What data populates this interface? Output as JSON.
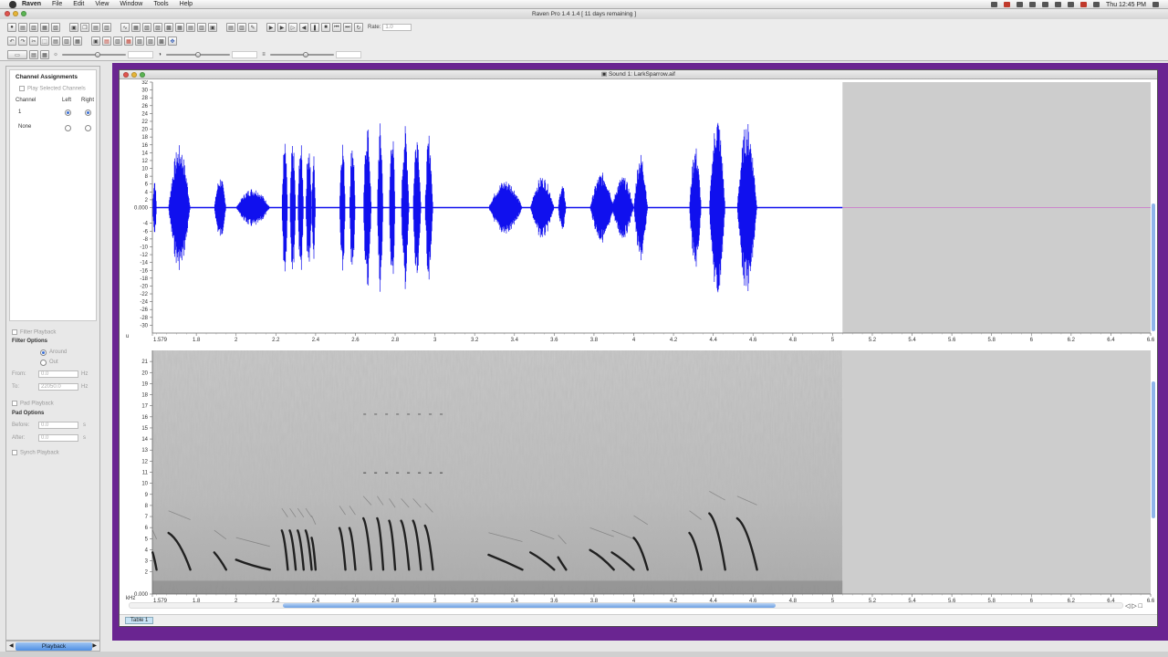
{
  "menubar": {
    "app": "Raven",
    "menus": [
      "File",
      "Edit",
      "View",
      "Window",
      "Tools",
      "Help"
    ],
    "clock": "Thu 12:45 PM"
  },
  "window": {
    "title": "Raven Pro 1.4  1.4  [ 11 days remaining ]"
  },
  "toolbar": {
    "rate_label": "Rate:",
    "rate_value": "1.0"
  },
  "channel_panel": {
    "title": "Channel Assignments",
    "play_selected": "Play Selected Channels",
    "col_channel": "Channel",
    "col_left": "Left",
    "col_right": "Right",
    "row1": "1",
    "row2": "None"
  },
  "filter": {
    "filter_playback": "Filter Playback",
    "title": "Filter Options",
    "around": "Around",
    "out": "Out",
    "from_label": "From:",
    "from_value": "0.0",
    "from_unit": "Hz",
    "to_label": "To:",
    "to_value": "22050.0",
    "to_unit": "Hz"
  },
  "pad": {
    "pad_playback": "Pad Playback",
    "title": "Pad Options",
    "before_label": "Before:",
    "before_value": "0.0",
    "before_unit": "s",
    "after_label": "After:",
    "after_value": "0.0",
    "after_unit": "s"
  },
  "synch": "Synch Playback",
  "side_tab": "Playback",
  "sound_window": {
    "title": "Sound 1: LarkSparrow.aif"
  },
  "table_tab": "Table 1",
  "waveform": {
    "unit_label": "u",
    "y_ticks": [
      "32",
      "30",
      "28",
      "26",
      "24",
      "22",
      "20",
      "18",
      "16",
      "14",
      "12",
      "10",
      "8",
      "6",
      "4",
      "2",
      "0.000",
      "-4",
      "-6",
      "-8",
      "-10",
      "-12",
      "-14",
      "-16",
      "-18",
      "-20",
      "-22",
      "-24",
      "-26",
      "-28",
      "-30"
    ],
    "zero_label": "0.000"
  },
  "spectrogram": {
    "unit_label": "kHz",
    "y_ticks": [
      "21",
      "20",
      "19",
      "18",
      "17",
      "16",
      "15",
      "14",
      "13",
      "12",
      "11",
      "10",
      "9",
      "8",
      "7",
      "6",
      "5",
      "4",
      "3",
      "2",
      "0.000"
    ]
  },
  "time_axis": {
    "unit_label": "s",
    "ticks": [
      "1.579",
      "1.8",
      "2",
      "2.2",
      "2.4",
      "2.6",
      "2.8",
      "3",
      "3.2",
      "3.4",
      "3.6",
      "3.8",
      "4",
      "4.2",
      "4.4",
      "4.6",
      "4.8",
      "5",
      "5.2",
      "5.4",
      "5.6",
      "5.8",
      "6",
      "6.2",
      "6.4",
      "6.6"
    ]
  },
  "colors": {
    "waveform": "#1010ee",
    "workspace": "#6a2591",
    "cursor_line": "#cc44cc"
  },
  "chart_data": {
    "type": "line",
    "x_range_s": [
      1.579,
      6.6
    ],
    "sound_end_s": 5.05,
    "waveform_ylim": [
      -32,
      32
    ],
    "spectrogram_ylim_khz": [
      0,
      22
    ],
    "bursts": [
      {
        "start": 1.58,
        "end": 1.6,
        "amp": 8
      },
      {
        "start": 1.66,
        "end": 1.77,
        "amp": 16
      },
      {
        "start": 1.89,
        "end": 1.95,
        "amp": 8
      },
      {
        "start": 2.0,
        "end": 2.17,
        "amp": 5
      },
      {
        "start": 2.23,
        "end": 2.26,
        "amp": 17
      },
      {
        "start": 2.27,
        "end": 2.3,
        "amp": 17
      },
      {
        "start": 2.31,
        "end": 2.34,
        "amp": 17
      },
      {
        "start": 2.35,
        "end": 2.38,
        "amp": 17
      },
      {
        "start": 2.38,
        "end": 2.4,
        "amp": 14
      },
      {
        "start": 2.52,
        "end": 2.55,
        "amp": 18
      },
      {
        "start": 2.57,
        "end": 2.6,
        "amp": 18
      },
      {
        "start": 2.64,
        "end": 2.68,
        "amp": 22
      },
      {
        "start": 2.71,
        "end": 2.74,
        "amp": 22
      },
      {
        "start": 2.77,
        "end": 2.8,
        "amp": 21
      },
      {
        "start": 2.83,
        "end": 2.87,
        "amp": 21
      },
      {
        "start": 2.89,
        "end": 2.93,
        "amp": 21
      },
      {
        "start": 2.95,
        "end": 2.99,
        "amp": 19
      },
      {
        "start": 3.27,
        "end": 3.44,
        "amp": 7
      },
      {
        "start": 3.48,
        "end": 3.6,
        "amp": 8
      },
      {
        "start": 3.62,
        "end": 3.66,
        "amp": 6
      },
      {
        "start": 3.78,
        "end": 3.9,
        "amp": 9
      },
      {
        "start": 3.89,
        "end": 4.0,
        "amp": 8
      },
      {
        "start": 4.0,
        "end": 4.07,
        "amp": 14
      },
      {
        "start": 4.28,
        "end": 4.34,
        "amp": 16
      },
      {
        "start": 4.38,
        "end": 4.46,
        "amp": 24
      },
      {
        "start": 4.52,
        "end": 4.62,
        "amp": 22
      }
    ]
  }
}
